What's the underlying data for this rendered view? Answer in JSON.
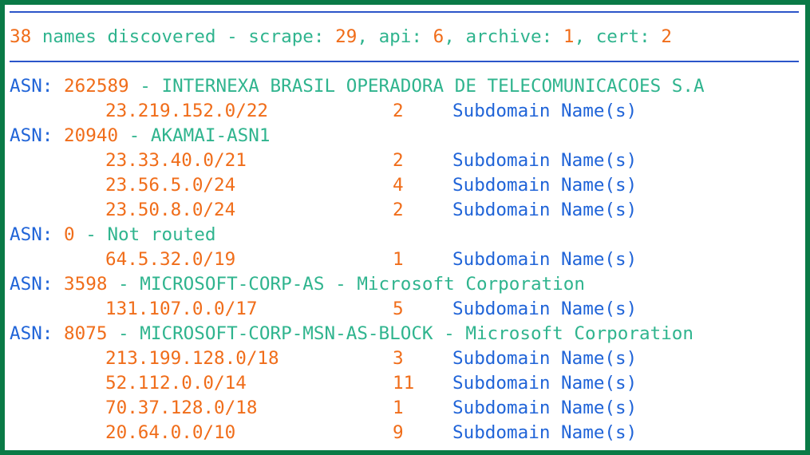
{
  "summary": {
    "total": "38",
    "text": "names discovered",
    "sep": " - ",
    "sources": [
      {
        "label": "scrape",
        "count": "29"
      },
      {
        "label": "api",
        "count": "6"
      },
      {
        "label": "archive",
        "count": "1"
      },
      {
        "label": "cert",
        "count": "2"
      }
    ]
  },
  "asn_label": "ASN:",
  "suffix": "Subdomain Name(s)",
  "asns": [
    {
      "number": "262589",
      "name": "INTERNEXA BRASIL OPERADORA DE TELECOMUNICACOES S.A",
      "netblocks": [
        {
          "cidr": "23.219.152.0/22",
          "count": "2"
        }
      ]
    },
    {
      "number": "20940",
      "name": "AKAMAI-ASN1",
      "netblocks": [
        {
          "cidr": "23.33.40.0/21",
          "count": "2"
        },
        {
          "cidr": "23.56.5.0/24",
          "count": "4"
        },
        {
          "cidr": "23.50.8.0/24",
          "count": "2"
        }
      ]
    },
    {
      "number": "0",
      "name": "Not routed",
      "netblocks": [
        {
          "cidr": "64.5.32.0/19",
          "count": "1"
        }
      ]
    },
    {
      "number": "3598",
      "name": "MICROSOFT-CORP-AS - Microsoft Corporation",
      "netblocks": [
        {
          "cidr": "131.107.0.0/17",
          "count": "5"
        }
      ]
    },
    {
      "number": "8075",
      "name": "MICROSOFT-CORP-MSN-AS-BLOCK - Microsoft Corporation",
      "netblocks": [
        {
          "cidr": "213.199.128.0/18",
          "count": "3"
        },
        {
          "cidr": "52.112.0.0/14",
          "count": "11"
        },
        {
          "cidr": "70.37.128.0/18",
          "count": "1"
        },
        {
          "cidr": "20.64.0.0/10",
          "count": "9"
        }
      ]
    }
  ]
}
